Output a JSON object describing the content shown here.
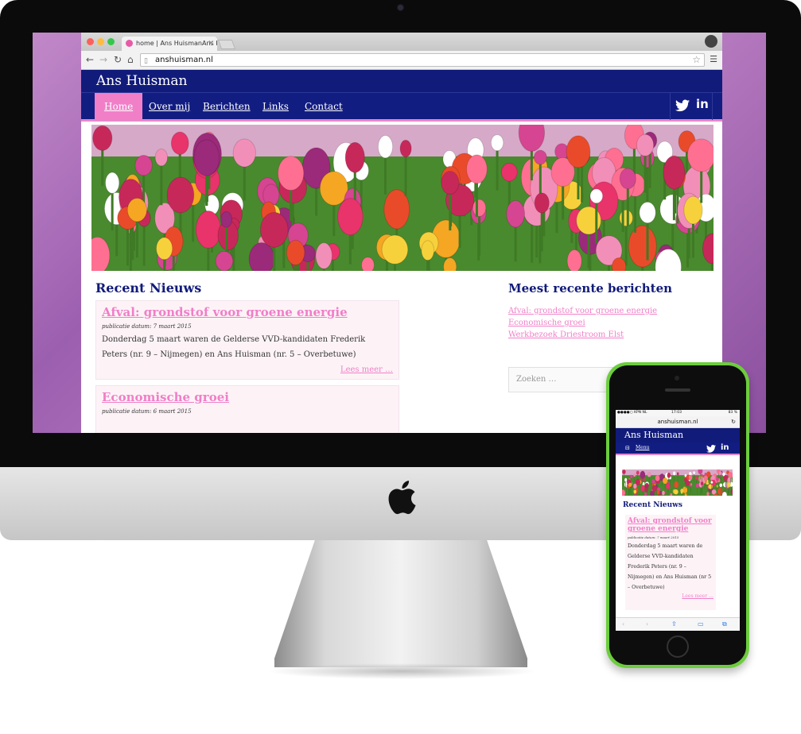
{
  "browser": {
    "tab_title": "home | Ans HuismanAns H",
    "url": "anshuisman.nl"
  },
  "site": {
    "title": "Ans Huisman",
    "nav": [
      "Home",
      "Over mij",
      "Berichten",
      "Links",
      "Contact"
    ],
    "active_nav": "Home",
    "social": [
      "twitter-icon",
      "linkedin-icon"
    ]
  },
  "main": {
    "heading": "Recent Nieuws",
    "posts": [
      {
        "title": "Afval: grondstof voor groene energie",
        "date": "publicatie datum: 7 maart 2015",
        "excerpt": "Donderdag 5 maart waren de Gelderse VVD-kandidaten Frederik Peters (nr. 9 – Nijmegen) en Ans Huisman (nr. 5 – Overbetuwe)",
        "more": "Lees meer …"
      },
      {
        "title": "Economische groei",
        "date": "publicatie datum: 6 maart 2015"
      }
    ]
  },
  "sidebar": {
    "heading": "Meest recente berichten",
    "links": [
      "Afval: grondstof voor groene energie",
      "Economische groei",
      "Werkbezoek Driestroom Elst"
    ],
    "search_placeholder": "Zoeken …"
  },
  "phone": {
    "carrier": "●●●●○ KPN NL",
    "time": "17:03",
    "battery": "83 %",
    "url": "anshuisman.nl",
    "site_title": "Ans Huisman",
    "menu_label": "Menu",
    "heading": "Recent Nieuws",
    "post": {
      "title": "Afval: grondstof voor groene energie",
      "date": "publicatie datum: 7 maart 2015",
      "excerpt": "Donderdag 5 maart waren de Gelderse VVD-kandidaten Frederik Peters (nr. 9 – Nijmegen) en Ans Huisman (nr 5 – Overbetuwe)",
      "more": "Lees meer …"
    }
  },
  "colors": {
    "brand_navy": "#111b7a",
    "accent_pink": "#f07fc8",
    "phone_green": "#6ccd3c"
  }
}
